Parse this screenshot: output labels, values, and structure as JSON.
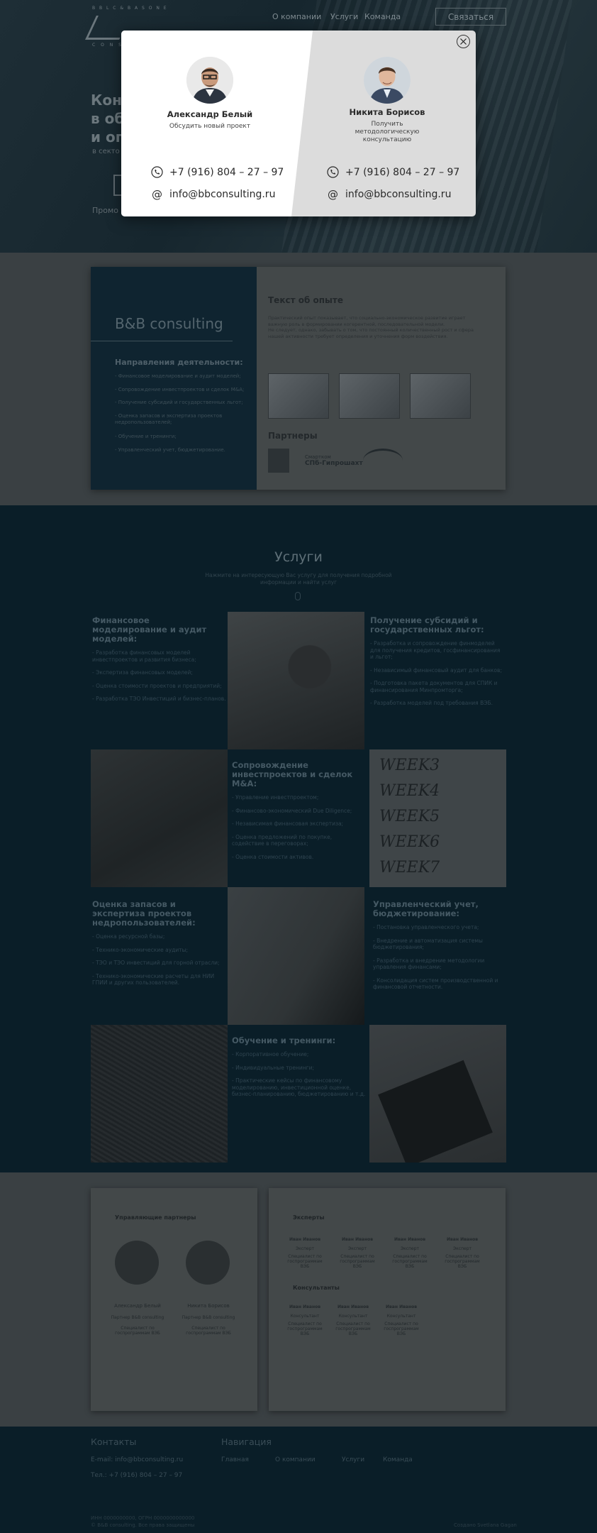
{
  "header": {
    "logo_top": "B B L C  &  B A S O N E",
    "logo_bottom": "C O N S U L T I N G",
    "nav": [
      "О компании",
      "Услуги",
      "Команда"
    ],
    "contact_button": "Связаться"
  },
  "hero": {
    "title_lines": [
      "Конс",
      "в об",
      "и оп"
    ],
    "subtitle": "в секто",
    "more": "Промо"
  },
  "modal": {
    "left": {
      "name": "Александр Белый",
      "subtitle": "Обсудить новый проект",
      "phone": "+7 (916) 804 – 27 – 97",
      "email": "info@bbconsulting.ru"
    },
    "right": {
      "name": "Никита Борисов",
      "subtitle": "Получить методологическую консультацию",
      "phone": "+7 (916) 804 – 27 – 97",
      "email": "info@bbconsulting.ru"
    }
  },
  "about": {
    "brand": "B&B consulting",
    "directions_title": "Направления деятельности:",
    "directions": [
      "- Финансовое моделирование и аудит моделей;",
      "- Сопровождение инвестпроектов и сделок M&A;",
      "- Получение субсидий и государственных льгот;",
      "- Оценка запасов и экспертиза проектов недропользователей;",
      "- Обучение и тренинги;",
      "- Управленческий учет, бюджетирование."
    ],
    "experience_title": "Текст об опыте",
    "experience_text_1": "Практический опыт показывает, что социально-экономическое развитие играет важную роль в формировании когерентной, последовательной модели.",
    "experience_text_2": "Не следует, однако, забывать о том, что постоянный количественный рост и сфера нашей активности требует определения и уточнения форм воздействия.",
    "partners_title": "Партнеры",
    "partners": [
      "Смартком",
      "СПб-Гипрошахт",
      "Gazprom"
    ]
  },
  "services": {
    "title": "Услуги",
    "subtitle": "Нажмите на интересующую Вас услугу для получения подробной информации и найти услуг",
    "blocks": [
      {
        "title": "Финансовое моделирование и аудит моделей:",
        "items": [
          "- Разработка финансовых моделей инвестпроектов и развития бизнеса;",
          "- Экспертиза финансовых моделей;",
          "- Оценка стоимости проектов и предприятий;",
          "- Разработка ТЭО Инвестиций и бизнес-планов."
        ]
      },
      {
        "title": "Получение субсидий и государственных льгот:",
        "items": [
          "- Разработка и сопровождение финмоделей для получения кредитов, госфинансирования и льгот;",
          "- Независимый финансовый аудит для банков;",
          "- Подготовка пакета документов для СПИК и финансирования Минпромторга;",
          "- Разработка моделей под требования ВЭБ."
        ]
      },
      {
        "title": "Сопровождение инвестпроектов и сделок M&A:",
        "items": [
          "- Управление инвестпроектом;",
          "- Финансово-экономический Due Diligence;",
          "- Независимая финансовая экспертиза;",
          "- Оценка предложений по покупке, содействие в переговорах;",
          "- Оценка стоимости активов."
        ]
      },
      {
        "title": "Оценка запасов и экспертиза проектов недропользователей:",
        "items": [
          "- Оценка ресурсной базы;",
          "- Технико-экономические аудиты;",
          "- ТЭО и ТЭО инвестиций для горной отрасли;",
          "- Технико-экономические расчеты для НИИ ГПИИ и других пользователей."
        ]
      },
      {
        "title": "Управленческий учет, бюджетирование:",
        "items": [
          "- Постановка управленческого учета;",
          "- Внедрение и автоматизация системы бюджетирования;",
          "- Разработка и внедрение методологии управления финансами;",
          "- Консолидация систем производственной и финансовой отчетности."
        ]
      },
      {
        "title": "Обучение и тренинги:",
        "items": [
          "- Корпоративное обучение;",
          "- Индивидуальные тренинги;",
          "- Практические кейсы по финансовому моделированию, инвестиционной оценке, бизнес-планированию, бюджетированию и т.д."
        ]
      }
    ],
    "week_labels": [
      "WEEK3",
      "WEEK4",
      "WEEK5",
      "WEEK6",
      "WEEK7"
    ]
  },
  "team": {
    "partners_title": "Управляющие партнеры",
    "partners": [
      {
        "name": "Александр Белый",
        "role": "Партнер B&B consulting",
        "note": "Специалист по госпрограммам ВЭБ"
      },
      {
        "name": "Никита Борисов",
        "role": "Партнер B&B consulting",
        "note": "Специалист по госпрограммам ВЭБ"
      }
    ],
    "experts_title": "Эксперты",
    "experts": [
      {
        "name": "Иван Иванов",
        "role": "Эксперт",
        "note": "Специалист по госпрограммам ВЭБ"
      },
      {
        "name": "Иван Иванов",
        "role": "Эксперт",
        "note": "Специалист по госпрограммам ВЭБ"
      },
      {
        "name": "Иван Иванов",
        "role": "Эксперт",
        "note": "Специалист по госпрограммам ВЭБ"
      },
      {
        "name": "Иван Иванов",
        "role": "Эксперт",
        "note": "Специалист по госпрограммам ВЭБ"
      }
    ],
    "consultants_title": "Консультанты",
    "consultants": [
      {
        "name": "Иван Иванов",
        "role": "Консультант",
        "note": "Специалист по госпрограммам ВЭБ"
      },
      {
        "name": "Иван Иванов",
        "role": "Консультант",
        "note": "Специалист по госпрограммам ВЭБ"
      },
      {
        "name": "Иван Иванов",
        "role": "Консультант",
        "note": "Специалист по госпрограммам ВЭБ"
      }
    ]
  },
  "footer": {
    "contacts_title": "Контакты",
    "email": "E-mail: info@bbconsulting.ru",
    "phone": "Тел.: +7 (916) 804 – 27 – 97",
    "nav_title": "Навигация",
    "nav": [
      "Главная",
      "О компании",
      "Услуги",
      "Команда"
    ],
    "inn": "ИНН 0000000000, ОГРН 0000000000000",
    "copyright": "© B&B consulting. Все права защищены",
    "credit": "Создано Svetlana Gagan"
  }
}
